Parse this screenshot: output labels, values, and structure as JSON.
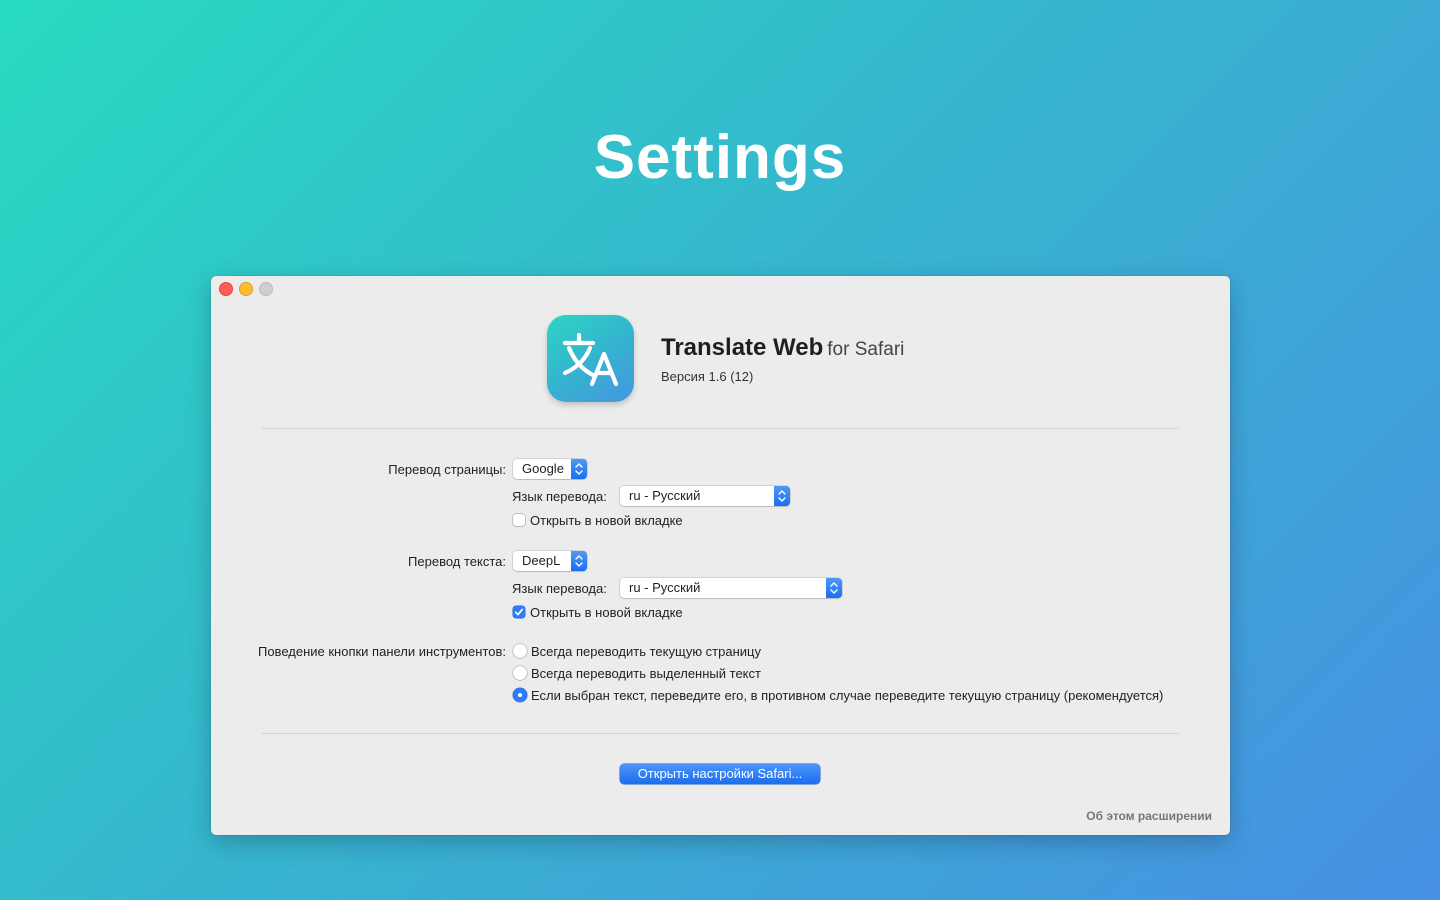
{
  "page": {
    "title": "Settings"
  },
  "app": {
    "name": "Translate Web",
    "subtitle": "for Safari",
    "version": "Версия 1.6 (12)"
  },
  "page_translation": {
    "label": "Перевод страницы:",
    "service": "Google",
    "language_label": "Язык перевода:",
    "language": "ru - Русский",
    "open_new_tab_label": "Открыть в новой вкладке",
    "open_new_tab_checked": false
  },
  "text_translation": {
    "label": "Перевод текста:",
    "service": "DeepL",
    "language_label": "Язык перевода:",
    "language": "ru - Русский",
    "open_new_tab_label": "Открыть в новой вкладке",
    "open_new_tab_checked": true
  },
  "toolbar_behavior": {
    "label": "Поведение кнопки панели инструментов:",
    "options": [
      {
        "label": "Всегда переводить текущую страницу",
        "selected": false
      },
      {
        "label": "Всегда переводить выделенный текст",
        "selected": false
      },
      {
        "label": "Если выбран текст, переведите его, в противном случае переведите текущую страницу (рекомендуется)",
        "selected": true
      }
    ]
  },
  "buttons": {
    "open_safari_settings": "Открыть настройки Safari...",
    "about": "Об этом расширении"
  },
  "colors": {
    "accent": "#2f7cf6",
    "window_bg": "#ececec",
    "background_gradient": [
      "#27dac0",
      "#37b4cf",
      "#4790e3"
    ]
  },
  "icons": {
    "app_icon": "translate-glyph-icon",
    "popup_indicator": "chevron-updown-icon",
    "checkmark": "checkmark-icon"
  }
}
